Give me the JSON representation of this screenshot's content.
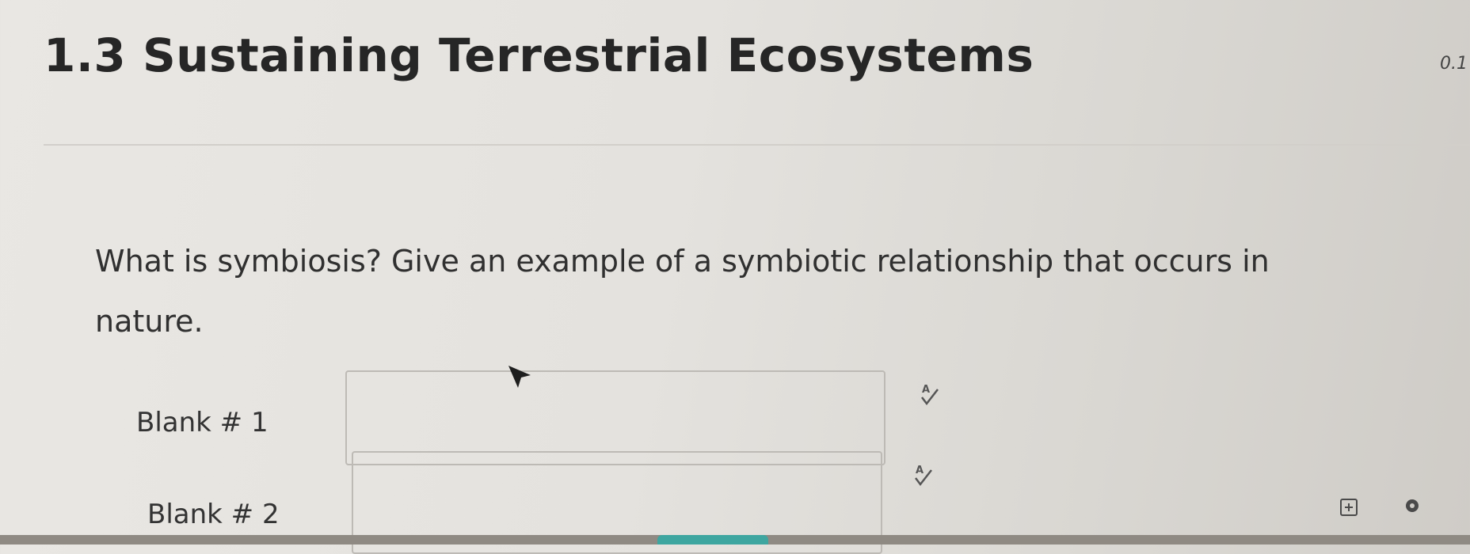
{
  "page": {
    "title": "1.3 Sustaining Terrestrial Ecosystems",
    "points": "0.1"
  },
  "question": {
    "line1": "What is symbiosis?  Give an example of a symbiotic relationship that occurs in",
    "line2": "nature."
  },
  "blanks": [
    {
      "label": "Blank # 1",
      "value": "",
      "spellcheck_icon": "spellcheck-icon"
    },
    {
      "label": "Blank # 2",
      "value": "",
      "spellcheck_icon": "spellcheck-icon"
    }
  ],
  "icons": {
    "cursor": "mouse-pointer-icon",
    "corner_left": "calculator-icon",
    "corner_right": "settings-dot-icon"
  },
  "colors": {
    "background": "#e4e2de",
    "title": "#262626",
    "input_border": "#bdbab5",
    "accent": "#3ea6a0"
  }
}
